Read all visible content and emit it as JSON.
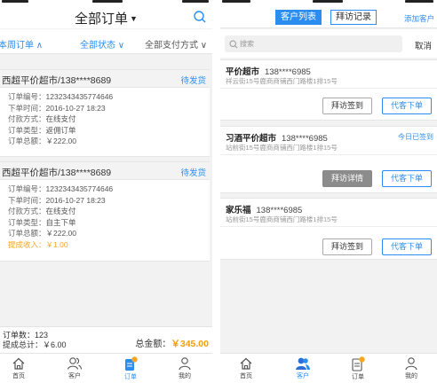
{
  "left": {
    "title": "全部订单",
    "filters": {
      "period": "本周订单",
      "state": "全部状态",
      "payment": "全部支付方式"
    },
    "orders": [
      {
        "store": "西超平价超市/138****8689",
        "status": "待发货",
        "lines": [
          {
            "label": "订单编号：",
            "value": "1232343435774646"
          },
          {
            "label": "下单时间：",
            "value": "2016-10-27 18:23"
          },
          {
            "label": "付款方式：",
            "value": "在线支付"
          },
          {
            "label": "订单类型：",
            "value": "返佣订单"
          },
          {
            "label": "订单总额：",
            "value": "￥222.00"
          }
        ]
      },
      {
        "store": "西超平价超市/138****8689",
        "status": "待发货",
        "lines": [
          {
            "label": "订单编号：",
            "value": "1232343435774646"
          },
          {
            "label": "下单时间：",
            "value": "2016-10-27 18:23"
          },
          {
            "label": "付款方式：",
            "value": "在线支付"
          },
          {
            "label": "订单类型：",
            "value": "自主下单"
          },
          {
            "label": "订单总额：",
            "value": "￥222.00"
          },
          {
            "label": "提成收入：",
            "value": "￥1.00"
          }
        ]
      }
    ],
    "summary": {
      "count": "订单数：123",
      "commission": "提成总计：￥6.00",
      "total_label": "总金额：",
      "total_value": "￥345.00"
    }
  },
  "right": {
    "segments": {
      "customers": "客户列表",
      "visits": "拜访记录"
    },
    "add_customer": "添加客户",
    "search": {
      "placeholder": "搜索",
      "cancel": "取消"
    },
    "customers": [
      {
        "name": "平价超市",
        "phone": "138****6985",
        "address": "祥云街15号鹿商商铺西门路楼1排15号",
        "buttons": {
          "visit": "拜访签到",
          "order": "代客下单"
        }
      },
      {
        "name": "习酒平价超市",
        "phone": "138****6985",
        "address": "站前街15号鹿商商铺西门路楼1排15号",
        "signed": "今日已签到",
        "buttons": {
          "visit": "拜访详情",
          "order": "代客下单"
        }
      },
      {
        "name": "家乐福",
        "phone": "138****6985",
        "address": "站前街15号鹿商商铺西门路楼1排15号",
        "buttons": {
          "visit": "拜访签到",
          "order": "代客下单"
        }
      }
    ]
  },
  "tabbar": {
    "home": "首页",
    "customers": "客户",
    "orders": "订单",
    "mine": "我的"
  },
  "colors": {
    "accent": "#2b8df0",
    "orange": "#f5a623",
    "total": "#f5a000"
  },
  "icons": [
    "search-icon",
    "home-icon",
    "customer-icon",
    "order-icon",
    "profile-icon"
  ]
}
